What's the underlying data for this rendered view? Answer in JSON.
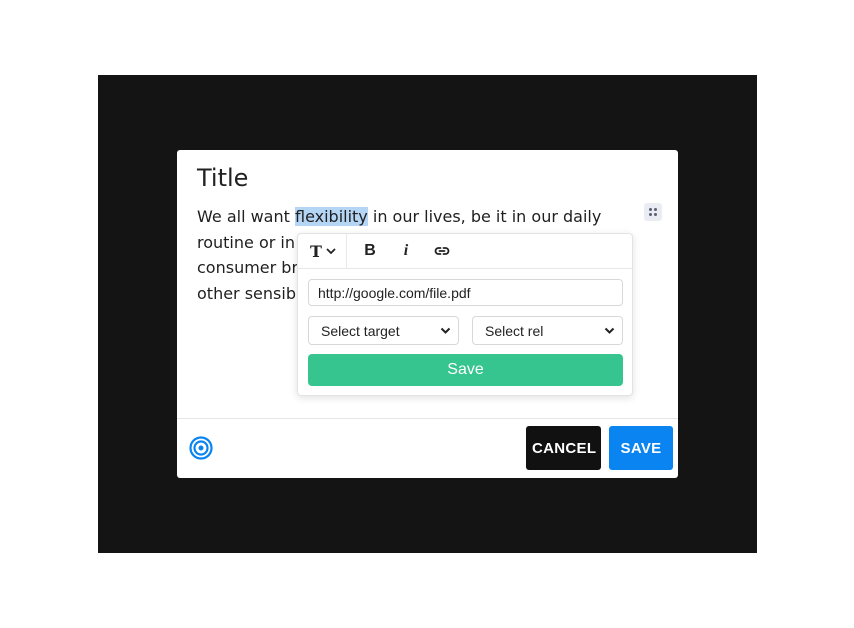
{
  "modal": {
    "title": "Title",
    "paragraph": {
      "before": "We all want ",
      "highlight": "flexibility",
      "after": " in our lives, be it in our daily routine or in our food choices, our clothing, the consumer brands we use, the work-life balance and other sensible choices."
    }
  },
  "popup": {
    "toolbar": {
      "text_style": "T",
      "bold": "B",
      "italic": "i"
    },
    "url_value": "http://google.com/file.pdf",
    "target_select": "Select target",
    "rel_select": "Select rel",
    "save_label": "Save"
  },
  "footer": {
    "cancel_label": "CANCEL",
    "save_label": "SAVE"
  },
  "colors": {
    "backdrop": "#141414",
    "highlight": "#b5d5f5",
    "popup_save": "#36c58f",
    "save_button": "#0a84f0",
    "cancel_button": "#111111",
    "target_icon": "#0a84f0"
  },
  "icons": [
    "drag-handle-icon",
    "text-style-icon",
    "chevron-down-icon",
    "bold-icon",
    "italic-icon",
    "link-icon",
    "target-icon"
  ]
}
